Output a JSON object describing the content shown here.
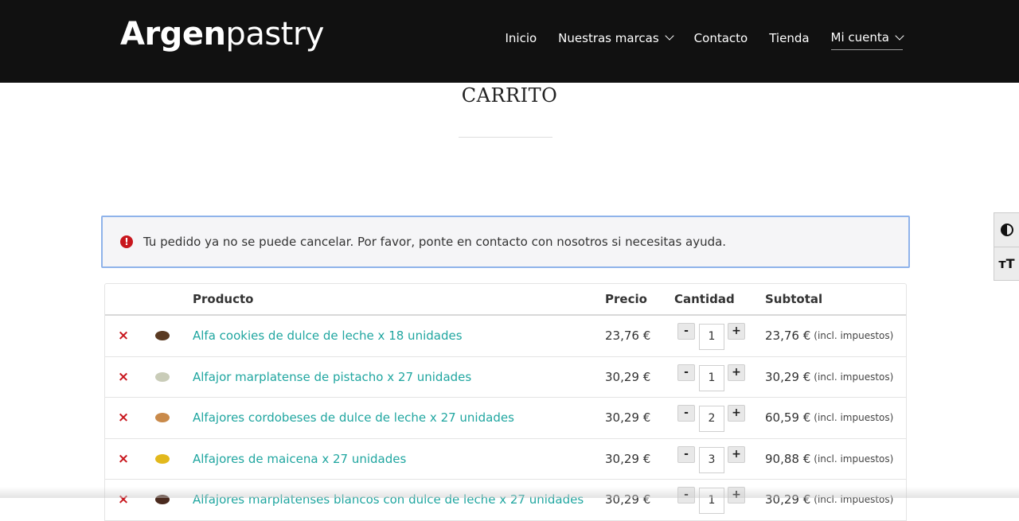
{
  "header": {
    "logo_bold": "Argen",
    "logo_light": "pastry",
    "nav": [
      {
        "label": "Inicio"
      },
      {
        "label": "Nuestras marcas"
      },
      {
        "label": "Contacto"
      },
      {
        "label": "Tienda"
      },
      {
        "label": "Mi cuenta"
      }
    ]
  },
  "page": {
    "title": "CARRITO"
  },
  "notice": {
    "icon": "error-icon",
    "icon_glyph": "!",
    "text": "Tu pedido ya no se puede cancelar. Por favor, ponte en contacto con nosotros si necesitas ayuda."
  },
  "cart": {
    "headers": {
      "product": "Producto",
      "price": "Precio",
      "quantity": "Cantidad",
      "subtotal": "Subtotal"
    },
    "remove_glyph": "×",
    "minus_glyph": "-",
    "plus_glyph": "+",
    "tax_note": "(incl. impuestos)",
    "rows": [
      {
        "name": "Alfa cookies de dulce de leche x 18 unidades",
        "price": "23,76 €",
        "qty": "1",
        "subtotal": "23,76 €",
        "thumb_color": "#5a3a22"
      },
      {
        "name": "Alfajor marplatense de pistacho x 27 unidades",
        "price": "30,29 €",
        "qty": "1",
        "subtotal": "30,29 €",
        "thumb_color": "#c9ccb8"
      },
      {
        "name": "Alfajores cordobeses de dulce de leche x 27 unidades",
        "price": "30,29 €",
        "qty": "2",
        "subtotal": "60,59 €",
        "thumb_color": "#c98a4a"
      },
      {
        "name": "Alfajores de maicena x 27 unidades",
        "price": "30,29 €",
        "qty": "3",
        "subtotal": "90,88 €",
        "thumb_color": "#e2b81c"
      },
      {
        "name": "Alfajores marplatenses blancos con dulce de leche x 27 unidades",
        "price": "30,29 €",
        "qty": "1",
        "subtotal": "30,29 €",
        "thumb_color": "#4a2a1e"
      }
    ]
  },
  "accessibility": {
    "contrast_icon": "contrast-icon",
    "text_size_icon": "text-size-icon",
    "text_size_glyph": "тT"
  }
}
